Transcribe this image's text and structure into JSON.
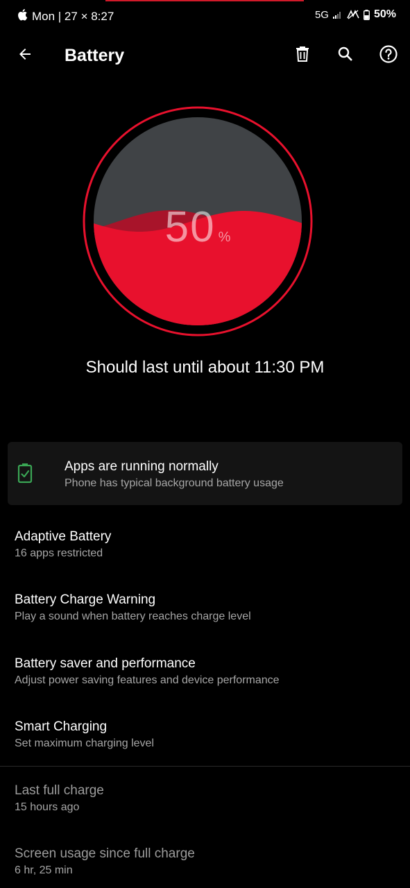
{
  "status_bar": {
    "carrier_time": "Mon | 27 × 8:27",
    "network": "5G",
    "battery_percent": "50%"
  },
  "app_bar": {
    "title": "Battery",
    "icons": [
      "back-arrow-icon",
      "delete-icon",
      "search-icon",
      "help-icon"
    ]
  },
  "gauge": {
    "level_percent": 50,
    "value": "50",
    "unit": "%",
    "ring_color": "#e8112d",
    "fill_color": "#e8112d",
    "empty_color": "#404346"
  },
  "estimate": "Should last until about 11:30 PM",
  "info_card": {
    "icon": "battery-ok-icon",
    "icon_color": "#3aa655",
    "title": "Apps are running normally",
    "subtitle": "Phone has typical background battery usage"
  },
  "items": [
    {
      "title": "Adaptive Battery",
      "subtitle": "16 apps restricted"
    },
    {
      "title": "Battery Charge Warning",
      "subtitle": "Play a sound when battery reaches charge level"
    },
    {
      "title": "Battery saver and performance",
      "subtitle": "Adjust power saving features and device performance"
    },
    {
      "title": "Smart Charging",
      "subtitle": "Set maximum charging level"
    }
  ],
  "stats": [
    {
      "title": "Last full charge",
      "subtitle": "15 hours ago"
    },
    {
      "title": "Screen usage since full charge",
      "subtitle": "6 hr, 25 min"
    }
  ]
}
